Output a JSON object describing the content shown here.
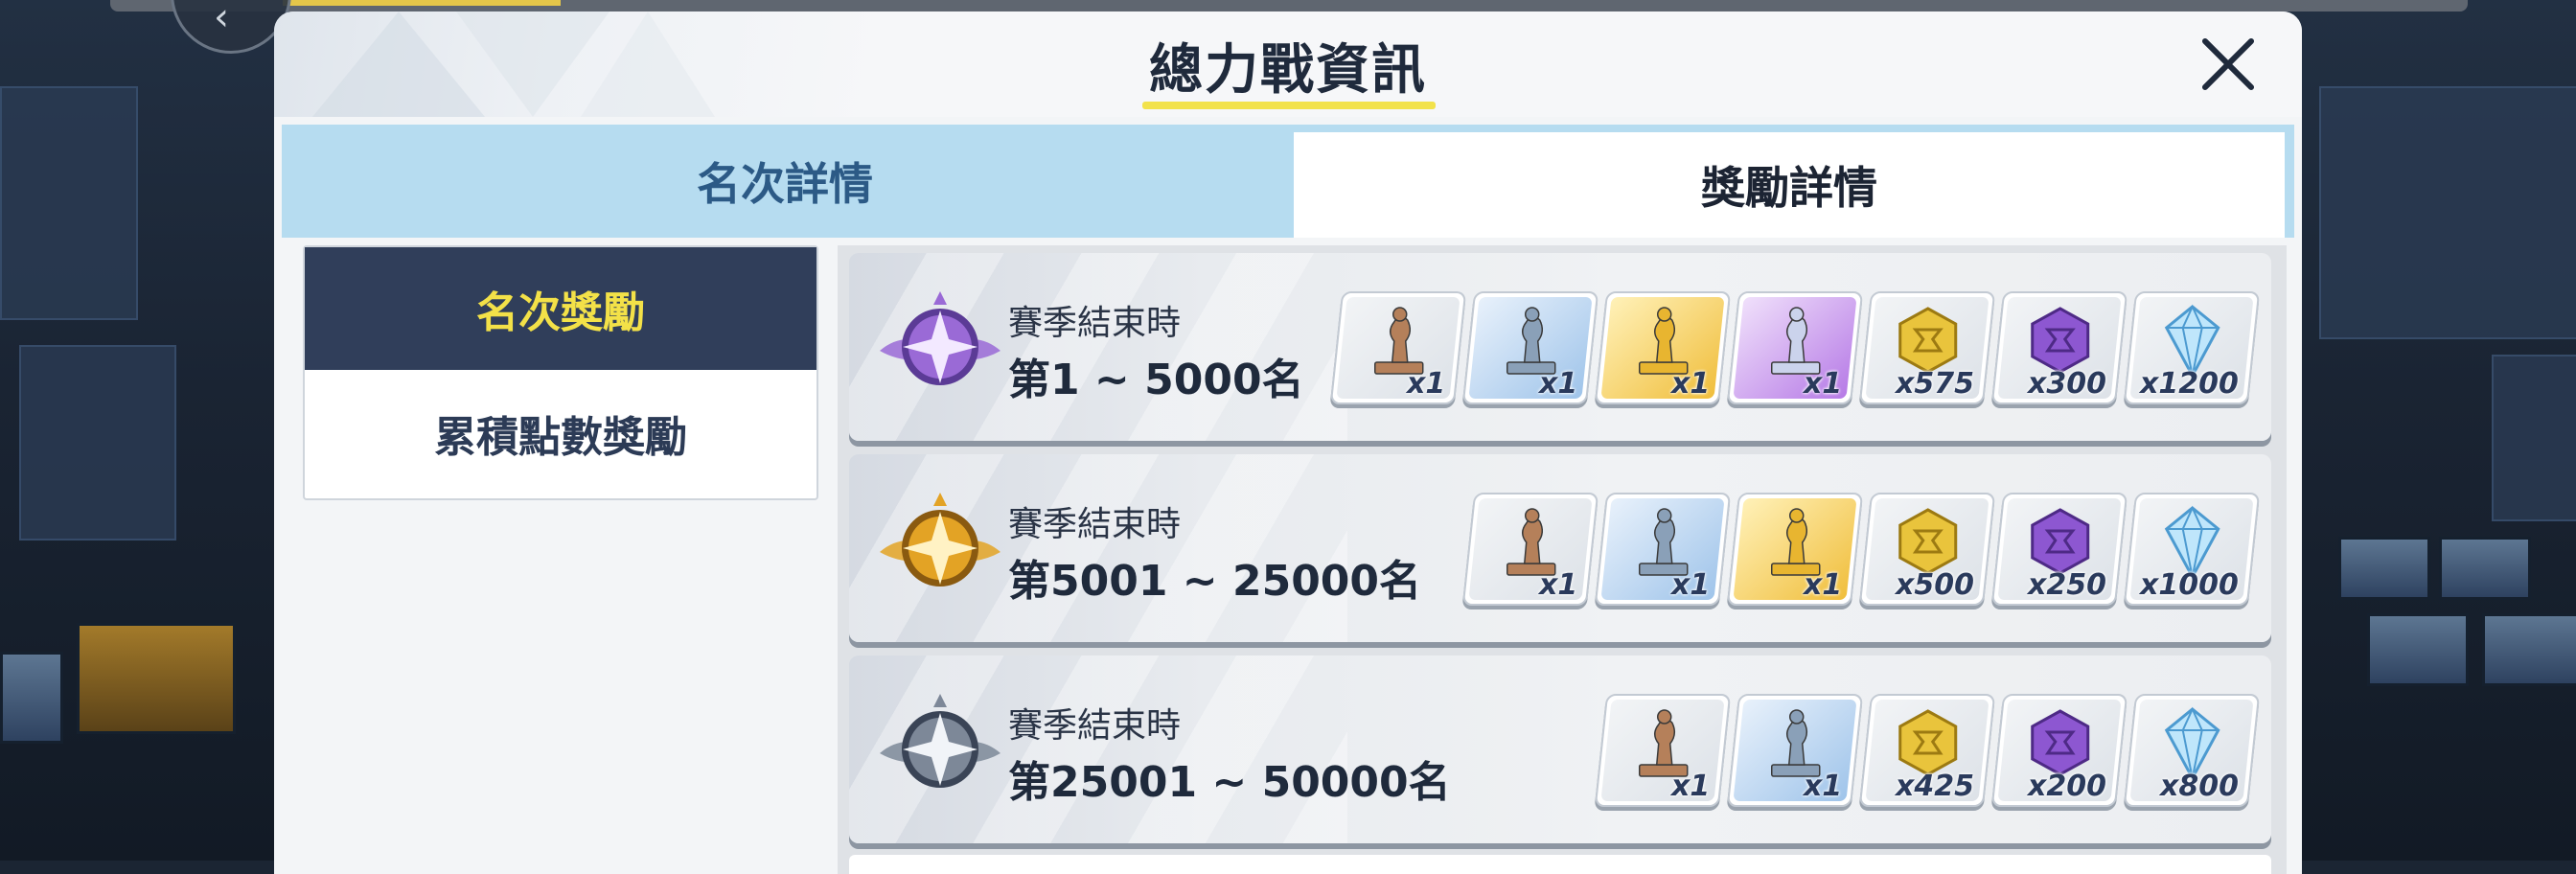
{
  "dialog": {
    "title": "總力戰資訊",
    "tabs": [
      {
        "label": "名次詳情",
        "active": false
      },
      {
        "label": "獎勵詳情",
        "active": true
      }
    ]
  },
  "side_menu": {
    "items": [
      {
        "label": "名次獎勵",
        "selected": true
      },
      {
        "label": "累積點數獎勵",
        "selected": false
      }
    ]
  },
  "rewards": [
    {
      "label": "賽季結束時",
      "rank": "第1 ~ 5000名",
      "badge": "purple",
      "items": [
        {
          "icon": "bronze-trophy-icon",
          "rarity": "white",
          "qty": "x1"
        },
        {
          "icon": "silver-trophy-icon",
          "rarity": "blue",
          "qty": "x1"
        },
        {
          "icon": "gold-trophy-icon",
          "rarity": "gold",
          "qty": "x1"
        },
        {
          "icon": "platinum-trophy-icon",
          "rarity": "purple",
          "qty": "x1"
        },
        {
          "icon": "gold-token-icon",
          "rarity": "white",
          "qty": "x575"
        },
        {
          "icon": "purple-token-icon",
          "rarity": "white",
          "qty": "x300"
        },
        {
          "icon": "crystal-icon",
          "rarity": "white",
          "qty": "x1200"
        }
      ]
    },
    {
      "label": "賽季結束時",
      "rank": "第5001 ~ 25000名",
      "badge": "gold",
      "items": [
        {
          "icon": "bronze-trophy-icon",
          "rarity": "white",
          "qty": "x1"
        },
        {
          "icon": "silver-trophy-icon",
          "rarity": "blue",
          "qty": "x1"
        },
        {
          "icon": "gold-trophy-icon",
          "rarity": "gold",
          "qty": "x1"
        },
        {
          "icon": "gold-token-icon",
          "rarity": "white",
          "qty": "x500"
        },
        {
          "icon": "purple-token-icon",
          "rarity": "white",
          "qty": "x250"
        },
        {
          "icon": "crystal-icon",
          "rarity": "white",
          "qty": "x1000"
        }
      ]
    },
    {
      "label": "賽季結束時",
      "rank": "第25001 ~ 50000名",
      "badge": "silver",
      "items": [
        {
          "icon": "bronze-trophy-icon",
          "rarity": "white",
          "qty": "x1"
        },
        {
          "icon": "silver-trophy-icon",
          "rarity": "blue",
          "qty": "x1"
        },
        {
          "icon": "gold-token-icon",
          "rarity": "white",
          "qty": "x425"
        },
        {
          "icon": "purple-token-icon",
          "rarity": "white",
          "qty": "x200"
        },
        {
          "icon": "crystal-icon",
          "rarity": "white",
          "qty": "x800"
        }
      ]
    }
  ],
  "colors": {
    "tab_inactive_bg": "#b6dcf0",
    "side_selected_bg": "#303e5a",
    "side_selected_text": "#f3e148",
    "title_underline": "#f2e24b"
  }
}
